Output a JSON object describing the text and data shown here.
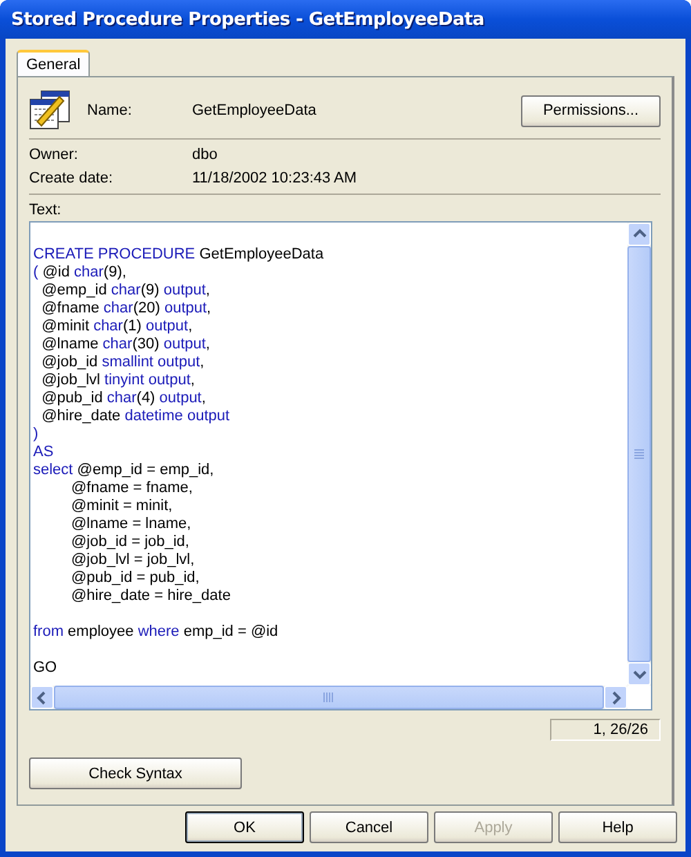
{
  "window": {
    "title": "Stored Procedure Properties - GetEmployeeData"
  },
  "tabs": [
    {
      "label": "General",
      "selected": true
    }
  ],
  "name": {
    "label": "Name:",
    "value": "GetEmployeeData"
  },
  "permissions_button": "Permissions...",
  "owner": {
    "label": "Owner:",
    "value": "dbo"
  },
  "create_date": {
    "label": "Create date:",
    "value": "11/18/2002 10:23:43 AM"
  },
  "text_label": "Text:",
  "code": {
    "lines": [
      {
        "kind": "blank"
      },
      {
        "kind": "code",
        "segments": [
          {
            "kind": "keyword",
            "text": "CREATE PROCEDURE"
          },
          {
            "kind": "plain",
            "text": " GetEmployeeData"
          }
        ]
      },
      {
        "kind": "code",
        "segments": [
          {
            "kind": "keyword",
            "text": "("
          },
          {
            "kind": "plain",
            "text": " @id "
          },
          {
            "kind": "keyword",
            "text": "char"
          },
          {
            "kind": "plain",
            "text": "(9),"
          }
        ]
      },
      {
        "kind": "code",
        "segments": [
          {
            "kind": "plain",
            "text": "  @emp_id "
          },
          {
            "kind": "keyword",
            "text": "char"
          },
          {
            "kind": "plain",
            "text": "(9) "
          },
          {
            "kind": "keyword",
            "text": "output"
          },
          {
            "kind": "plain",
            "text": ","
          }
        ]
      },
      {
        "kind": "code",
        "segments": [
          {
            "kind": "plain",
            "text": "  @fname "
          },
          {
            "kind": "keyword",
            "text": "char"
          },
          {
            "kind": "plain",
            "text": "(20) "
          },
          {
            "kind": "keyword",
            "text": "output"
          },
          {
            "kind": "plain",
            "text": ","
          }
        ]
      },
      {
        "kind": "code",
        "segments": [
          {
            "kind": "plain",
            "text": "  @minit "
          },
          {
            "kind": "keyword",
            "text": "char"
          },
          {
            "kind": "plain",
            "text": "(1) "
          },
          {
            "kind": "keyword",
            "text": "output"
          },
          {
            "kind": "plain",
            "text": ","
          }
        ]
      },
      {
        "kind": "code",
        "segments": [
          {
            "kind": "plain",
            "text": "  @lname "
          },
          {
            "kind": "keyword",
            "text": "char"
          },
          {
            "kind": "plain",
            "text": "(30) "
          },
          {
            "kind": "keyword",
            "text": "output"
          },
          {
            "kind": "plain",
            "text": ","
          }
        ]
      },
      {
        "kind": "code",
        "segments": [
          {
            "kind": "plain",
            "text": "  @job_id "
          },
          {
            "kind": "keyword",
            "text": "smallint output"
          },
          {
            "kind": "plain",
            "text": ","
          }
        ]
      },
      {
        "kind": "code",
        "segments": [
          {
            "kind": "plain",
            "text": "  @job_lvl "
          },
          {
            "kind": "keyword",
            "text": "tinyint output"
          },
          {
            "kind": "plain",
            "text": ","
          }
        ]
      },
      {
        "kind": "code",
        "segments": [
          {
            "kind": "plain",
            "text": "  @pub_id "
          },
          {
            "kind": "keyword",
            "text": "char"
          },
          {
            "kind": "plain",
            "text": "(4) "
          },
          {
            "kind": "keyword",
            "text": "output"
          },
          {
            "kind": "plain",
            "text": ","
          }
        ]
      },
      {
        "kind": "code",
        "segments": [
          {
            "kind": "plain",
            "text": "  @hire_date "
          },
          {
            "kind": "keyword",
            "text": "datetime output"
          }
        ]
      },
      {
        "kind": "code",
        "segments": [
          {
            "kind": "keyword",
            "text": ")"
          }
        ]
      },
      {
        "kind": "code",
        "segments": [
          {
            "kind": "keyword",
            "text": "AS"
          }
        ]
      },
      {
        "kind": "code",
        "segments": [
          {
            "kind": "keyword",
            "text": "select"
          },
          {
            "kind": "plain",
            "text": " @emp_id = emp_id,"
          }
        ]
      },
      {
        "kind": "code",
        "segments": [
          {
            "kind": "plain",
            "text": "         @fname = fname,"
          }
        ]
      },
      {
        "kind": "code",
        "segments": [
          {
            "kind": "plain",
            "text": "         @minit = minit,"
          }
        ]
      },
      {
        "kind": "code",
        "segments": [
          {
            "kind": "plain",
            "text": "         @lname = lname,"
          }
        ]
      },
      {
        "kind": "code",
        "segments": [
          {
            "kind": "plain",
            "text": "         @job_id = job_id,"
          }
        ]
      },
      {
        "kind": "code",
        "segments": [
          {
            "kind": "plain",
            "text": "         @job_lvl = job_lvl,"
          }
        ]
      },
      {
        "kind": "code",
        "segments": [
          {
            "kind": "plain",
            "text": "         @pub_id = pub_id,"
          }
        ]
      },
      {
        "kind": "code",
        "segments": [
          {
            "kind": "plain",
            "text": "         @hire_date = hire_date"
          }
        ]
      },
      {
        "kind": "blank"
      },
      {
        "kind": "code",
        "segments": [
          {
            "kind": "keyword",
            "text": "from"
          },
          {
            "kind": "plain",
            "text": " employee "
          },
          {
            "kind": "keyword",
            "text": "where"
          },
          {
            "kind": "plain",
            "text": " emp_id = @id"
          }
        ]
      },
      {
        "kind": "blank"
      },
      {
        "kind": "code",
        "segments": [
          {
            "kind": "plain",
            "text": "GO"
          }
        ]
      }
    ]
  },
  "cursor_position": "1, 26/26",
  "check_syntax_button": "Check Syntax",
  "buttons": [
    {
      "label": "OK",
      "default": true,
      "disabled": false
    },
    {
      "label": "Cancel",
      "default": false,
      "disabled": false
    },
    {
      "label": "Apply",
      "default": false,
      "disabled": true
    },
    {
      "label": "Help",
      "default": false,
      "disabled": false
    }
  ]
}
